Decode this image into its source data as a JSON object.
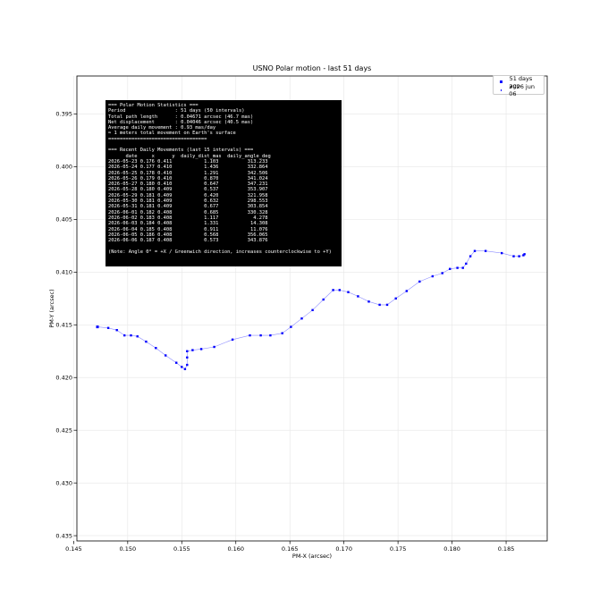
{
  "colors": {
    "series": "#0000ff",
    "grid": "#e6e6e6",
    "axes": "#000000",
    "box_bg": "#000000",
    "box_fg": "#ffffff"
  },
  "stats_box": {
    "lines": [
      "=== Polar Motion Statistics ===",
      "Period                 : 51 days (50 intervals)",
      "Total path length      : 0.04671 arcsec (46.7 mas)",
      "Net displacement       : 0.04046 arcsec (40.5 mas)",
      "Average daily movement : 0.93 mas/day",
      "≈ 1 meters total movement on Earth's surface",
      "==================================",
      "",
      "=== Recent Daily Movements (last 15 intervals) ===",
      "      date     x      y  daily_dist_mas  daily_angle_deg",
      "2026-05-23 0.176 0.411           1.103          313.233",
      "2026-05-24 0.177 0.410           1.436          332.864",
      "2026-05-25 0.178 0.410           1.291          342.506",
      "2026-05-26 0.179 0.410           0.870          341.024",
      "2026-05-27 0.180 0.410           0.647          347.231",
      "2026-05-28 0.180 0.409           0.537          353.907",
      "2026-05-29 0.181 0.409           0.420          321.958",
      "2026-05-30 0.181 0.409           0.632          298.553",
      "2026-05-31 0.181 0.409           0.677          303.854",
      "2026-06-01 0.182 0.408           0.685          330.328",
      "2026-06-02 0.183 0.408           1.117            4.278",
      "2026-06-03 0.184 0.408           1.331           14.308",
      "2026-06-04 0.185 0.408           0.911           11.076",
      "2026-06-05 0.186 0.408           0.568          356.065",
      "2026-06-06 0.187 0.408           0.573          343.876",
      "",
      "(Note: Angle 0° = +X / Greenwich direction, increases counterclockwise to +Y)"
    ]
  },
  "chart_data": {
    "type": "scatter",
    "title": "USNO Polar motion - last 51  days",
    "xlabel": "PM-X (arcsec)",
    "ylabel": "PM-Y (arcsec)",
    "xlim": [
      0.1453,
      0.1888
    ],
    "ylim": [
      0.4355,
      0.3914
    ],
    "y_inverted": true,
    "grid": true,
    "legend_position": "upper right",
    "legend": [
      "51 days ago",
      "2026 jun 06"
    ],
    "x_ticks": [
      0.145,
      0.15,
      0.155,
      0.16,
      0.165,
      0.17,
      0.175,
      0.18,
      0.185
    ],
    "x_tick_labels": [
      "0.145",
      "0.150",
      "0.155",
      "0.160",
      "0.165",
      "0.170",
      "0.175",
      "0.180",
      "0.185"
    ],
    "y_ticks": [
      0.395,
      0.4,
      0.405,
      0.41,
      0.415,
      0.42,
      0.425,
      0.43,
      0.435
    ],
    "y_tick_labels": [
      "0.395",
      "0.400",
      "0.405",
      "0.410",
      "0.415",
      "0.420",
      "0.425",
      "0.430",
      "0.435"
    ],
    "series": [
      {
        "x": [
          0.1472,
          0.1482,
          0.149,
          0.1497,
          0.1503,
          0.1509,
          0.1517,
          0.1526,
          0.1535,
          0.1545,
          0.155,
          0.1553,
          0.1555,
          0.1555,
          0.1555,
          0.156,
          0.1568,
          0.158,
          0.1597,
          0.1613,
          0.1623,
          0.1632,
          0.1643,
          0.1651,
          0.1661,
          0.1671,
          0.1681,
          0.169,
          0.1696,
          0.1704,
          0.1713,
          0.1723,
          0.1733,
          0.174,
          0.1748,
          0.1758,
          0.177,
          0.1782,
          0.1791,
          0.1798,
          0.1805,
          0.181,
          0.1813,
          0.1817,
          0.1821,
          0.1831,
          0.1846,
          0.1857,
          0.1862,
          0.1866,
          0.1867
        ],
        "y": [
          0.4152,
          0.4153,
          0.4155,
          0.416,
          0.416,
          0.4161,
          0.4166,
          0.4172,
          0.4179,
          0.4186,
          0.419,
          0.4192,
          0.4188,
          0.4181,
          0.4175,
          0.4174,
          0.4173,
          0.4171,
          0.4164,
          0.416,
          0.416,
          0.416,
          0.4158,
          0.4152,
          0.4144,
          0.4136,
          0.4126,
          0.4117,
          0.4117,
          0.4119,
          0.4123,
          0.4128,
          0.4131,
          0.4131,
          0.4125,
          0.4118,
          0.4109,
          0.4104,
          0.4101,
          0.4097,
          0.4096,
          0.4096,
          0.4092,
          0.4085,
          0.408,
          0.408,
          0.4082,
          0.4085,
          0.4085,
          0.4084,
          0.4083
        ]
      }
    ]
  }
}
